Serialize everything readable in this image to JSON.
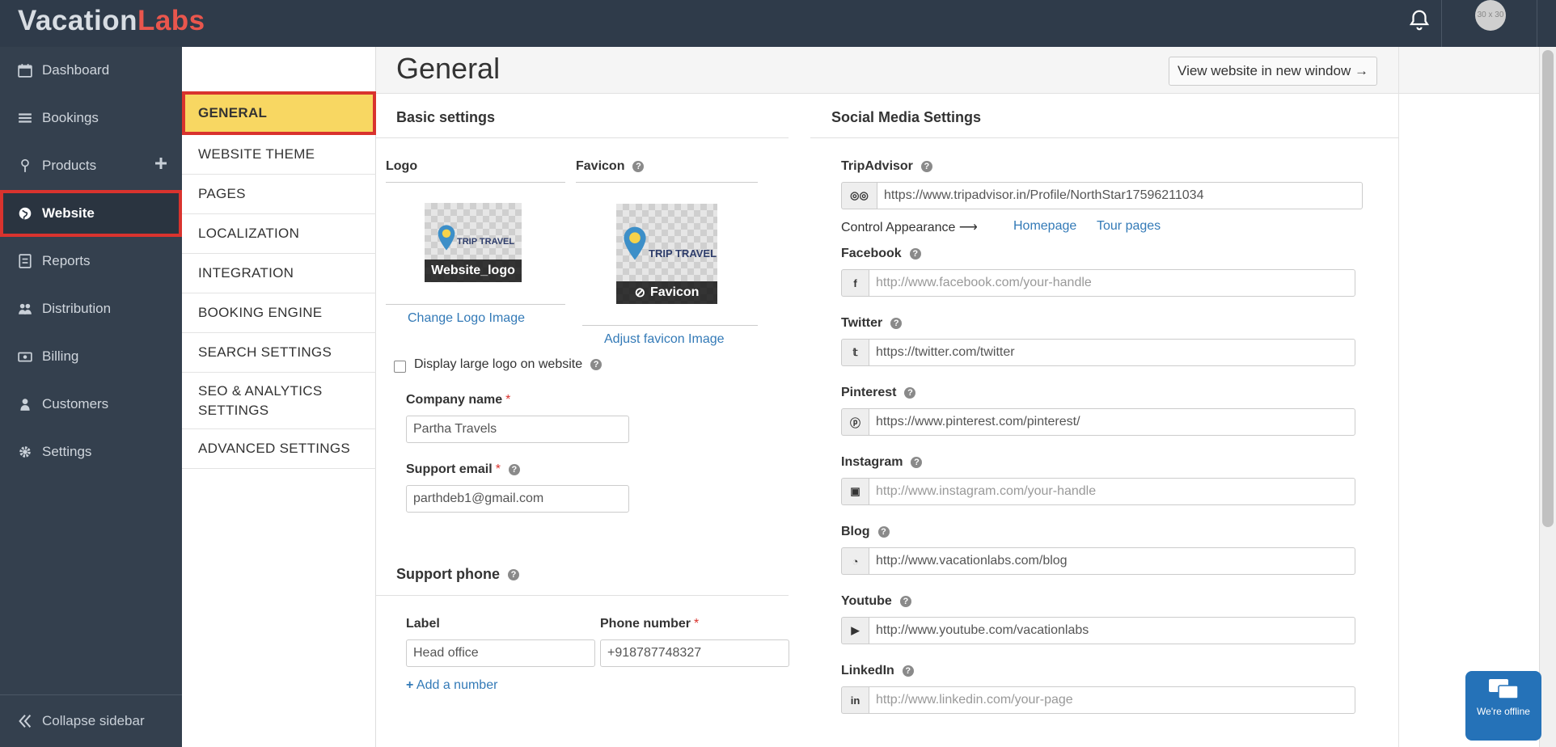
{
  "brand": {
    "part1": "Vacation",
    "part2": "Labs"
  },
  "avatar_text": "30 x 30",
  "sidebar": {
    "items": [
      {
        "label": "Dashboard",
        "icon": "calendar-icon"
      },
      {
        "label": "Bookings",
        "icon": "list-icon"
      },
      {
        "label": "Products",
        "icon": "map-pin-icon"
      },
      {
        "label": "Website",
        "icon": "globe-icon"
      },
      {
        "label": "Reports",
        "icon": "report-icon"
      },
      {
        "label": "Distribution",
        "icon": "users-icon"
      },
      {
        "label": "Billing",
        "icon": "money-icon"
      },
      {
        "label": "Customers",
        "icon": "user-icon"
      },
      {
        "label": "Settings",
        "icon": "gear-icon"
      }
    ],
    "collapse_label": "Collapse sidebar"
  },
  "submenu": {
    "items": [
      "GENERAL",
      "WEBSITE THEME",
      "PAGES",
      "LOCALIZATION",
      "INTEGRATION",
      "BOOKING ENGINE",
      "SEARCH SETTINGS",
      "SEO & ANALYTICS SETTINGS",
      "ADVANCED SETTINGS"
    ]
  },
  "header": {
    "title": "General",
    "view_button": "View website in new window →"
  },
  "basic": {
    "title": "Basic settings",
    "logo_label": "Logo",
    "favicon_label": "Favicon",
    "logo_caption": "Website_logo",
    "favicon_caption": "Favicon",
    "logo_brand_text": "TRIP TRAVEL",
    "favicon_brand_text": "TRIP TRAVEL",
    "change_logo": "Change Logo Image",
    "adjust_favicon": "Adjust favicon Image",
    "display_large_logo": "Display large logo on website",
    "company_name_label": "Company name",
    "company_name_value": "Partha Travels",
    "support_email_label": "Support email",
    "support_email_value": "parthdeb1@gmail.com",
    "required_mark": "*"
  },
  "phone": {
    "title": "Support phone",
    "label_col": "Label",
    "number_col": "Phone number",
    "label_value": "Head office",
    "number_value": "+918787748327",
    "add_number": "Add a number"
  },
  "social": {
    "title": "Social Media Settings",
    "tripadvisor_label": "TripAdvisor",
    "tripadvisor_value": "https://www.tripadvisor.in/Profile/NorthStar17596211034",
    "control_appearance": "Control Appearance ⟶",
    "homepage_link": "Homepage",
    "tour_pages_link": "Tour pages",
    "facebook_label": "Facebook",
    "facebook_placeholder": "http://www.facebook.com/your-handle",
    "twitter_label": "Twitter",
    "twitter_value": "https://twitter.com/twitter",
    "pinterest_label": "Pinterest",
    "pinterest_value": "https://www.pinterest.com/pinterest/",
    "instagram_label": "Instagram",
    "instagram_placeholder": "http://www.instagram.com/your-handle",
    "blog_label": "Blog",
    "blog_value": "http://www.vacationlabs.com/blog",
    "youtube_label": "Youtube",
    "youtube_value": "http://www.youtube.com/vacationlabs",
    "linkedin_label": "LinkedIn",
    "linkedin_placeholder": "http://www.linkedin.com/your-page"
  },
  "chat": {
    "status": "We're offline"
  },
  "colors": {
    "topbar": "#2f3b4a",
    "sidebar": "#34404e",
    "accent_red": "#d9332e",
    "active_submenu": "#f8d762",
    "link": "#337ab7"
  }
}
